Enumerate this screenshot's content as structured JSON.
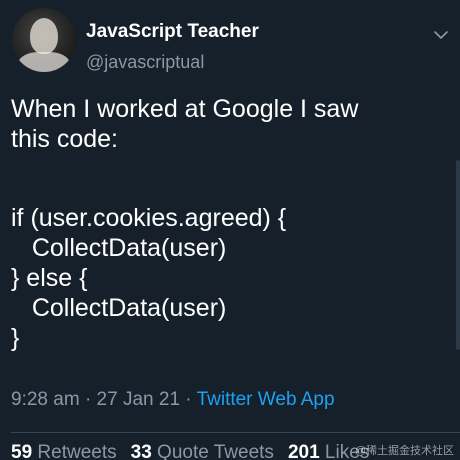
{
  "author": {
    "display_name": "JavaScript Teacher",
    "handle": "@javascriptual",
    "avatar_icon": "profile-photo"
  },
  "tweet": {
    "text_line_1": "When I worked at Google I saw",
    "text_line_2": "this code:",
    "code_lines": [
      "if (user.cookies.agreed) {",
      "   CollectData(user)",
      "} else {",
      "   CollectData(user)",
      "}"
    ]
  },
  "meta": {
    "time": "9:28 am",
    "date": "27 Jan 21",
    "separator": "·",
    "source": "Twitter Web App"
  },
  "stats": {
    "retweets_count": "59",
    "retweets_label": "Retweets",
    "quotes_count": "33",
    "quotes_label": "Quote Tweets",
    "likes_count": "201",
    "likes_label": "Likes"
  },
  "watermark": "@稀土掘金技术社区",
  "colors": {
    "background": "#15202b",
    "primary_text": "#ffffff",
    "secondary_text": "#8899a6",
    "link": "#1da1f2"
  }
}
